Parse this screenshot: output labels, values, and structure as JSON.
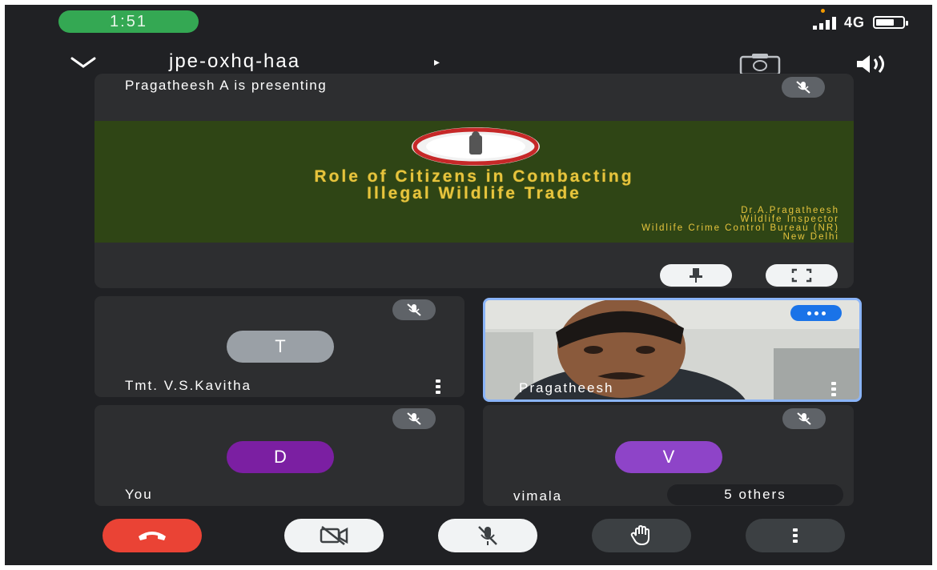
{
  "status_bar": {
    "time": "1:51",
    "network": "4G",
    "signal_bars": 3,
    "battery_level": 0.7
  },
  "top_bar": {
    "meeting_code": "jpe-oxhq-haa",
    "meeting_arrow": "▸",
    "icons": [
      "chevron-down-icon",
      "camera-switch-icon",
      "speaker-icon"
    ]
  },
  "presentation": {
    "presenter_text": "Pragatheesh A is presenting",
    "slide": {
      "title_line1": "Role of Citizens in Combacting",
      "title_line2": "Illegal Wildlife Trade",
      "credits": [
        "Dr.A.Pragatheesh",
        "Wildlife Inspector",
        "Wildlife Crime Control Bureau (NR)",
        "New Delhi"
      ]
    },
    "buttons": [
      "pin-icon",
      "fullscreen-icon"
    ]
  },
  "participants": [
    {
      "name": "Tmt. V.S.Kavitha",
      "initial": "T",
      "avatar_color": "#9aa0a6",
      "muted": true
    },
    {
      "name": "Pragatheesh",
      "has_video": true,
      "speaking": true
    },
    {
      "name": "You",
      "initial": "D",
      "avatar_color": "#7b1fa2",
      "muted": true
    },
    {
      "name": "vimala",
      "initial": "V",
      "avatar_color": "#8e44c8",
      "muted": true,
      "others_label": "5 others"
    }
  ],
  "controls": {
    "leave_color": "#ea4335",
    "icons": [
      "hang-up-icon",
      "camera-off-icon",
      "mic-off-icon",
      "raise-hand-icon",
      "more-options-icon"
    ]
  },
  "colors": {
    "background": "#202124",
    "tile": "#2d2e30",
    "accent_blue": "#1a73e8",
    "slide_bg": "#2f4515",
    "slide_text": "#e6c43d",
    "time_pill": "#34a853"
  }
}
